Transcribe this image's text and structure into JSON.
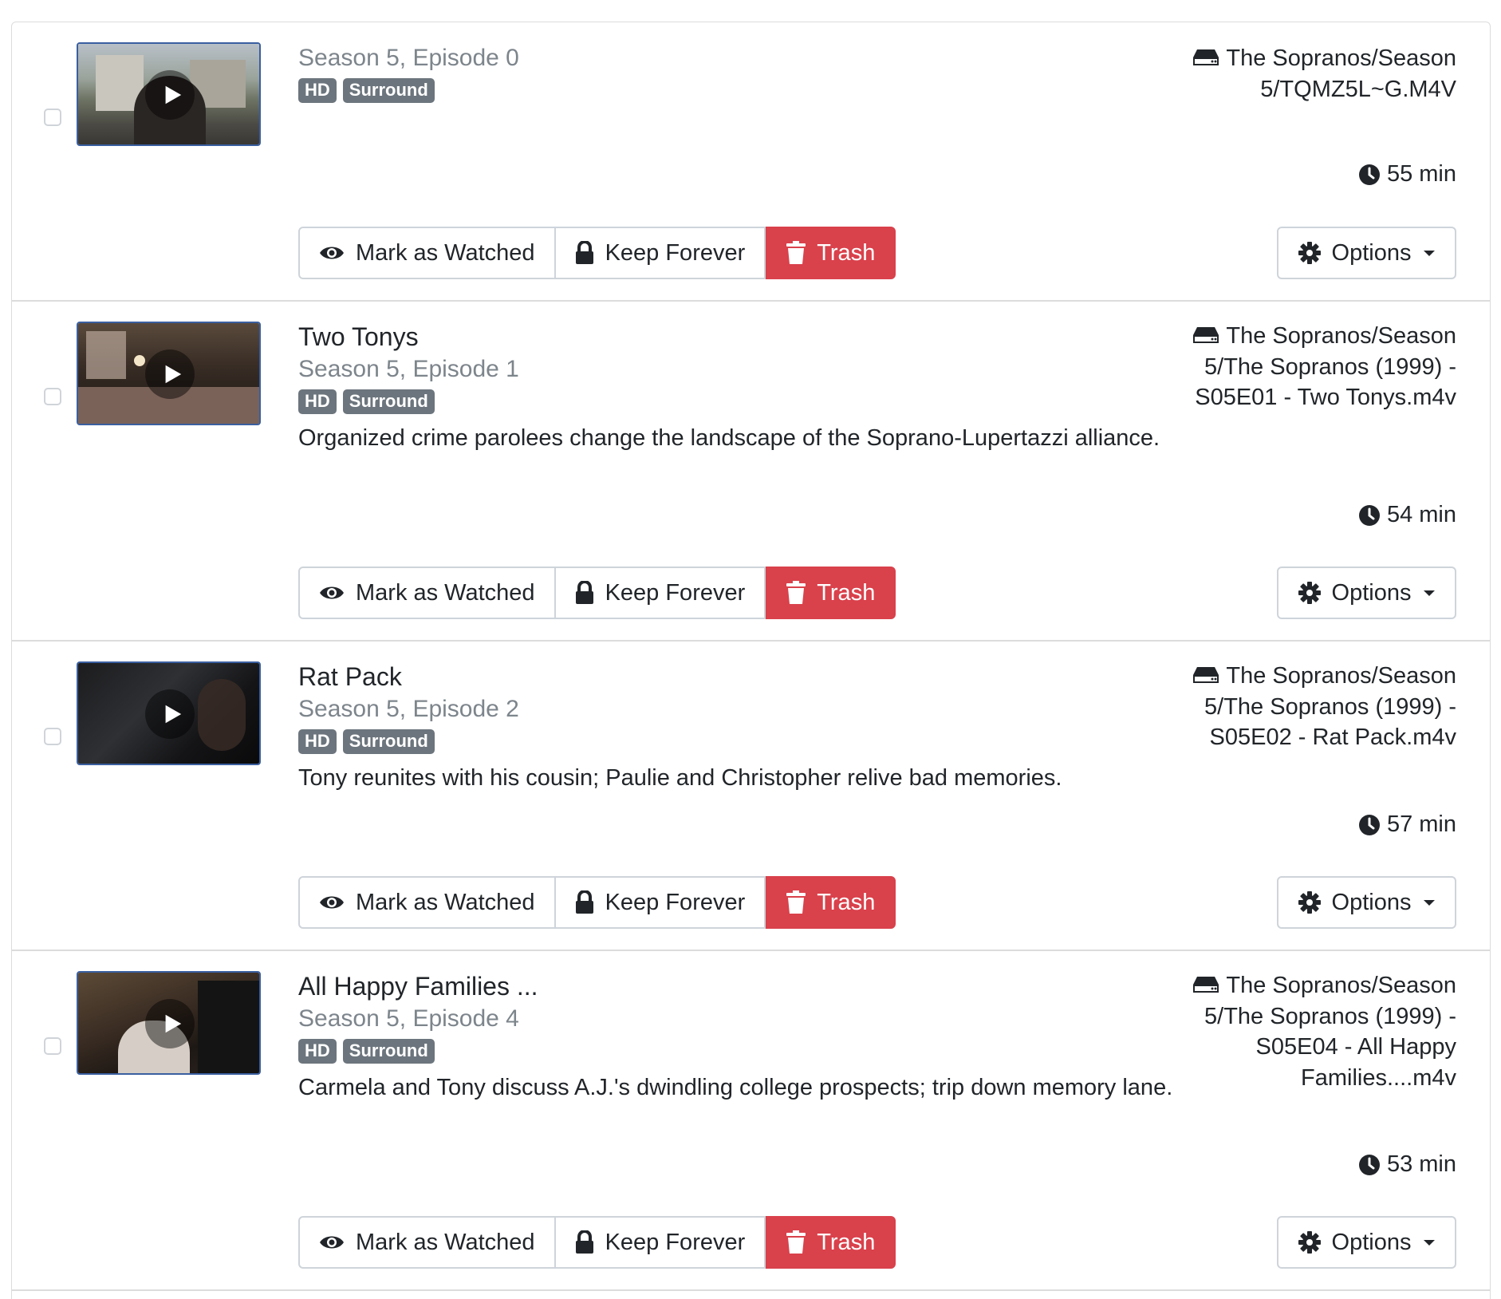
{
  "episodes": [
    {
      "title": "",
      "episode": "Season 5, Episode 0",
      "badges": [
        "HD",
        "Surround"
      ],
      "description": "",
      "path": "The Sopranos/Season 5/TQMZ5L~G.M4V",
      "duration": "55 min"
    },
    {
      "title": "Two Tonys",
      "episode": "Season 5, Episode 1",
      "badges": [
        "HD",
        "Surround"
      ],
      "description": "Organized crime parolees change the landscape of the Soprano-Lupertazzi alliance.",
      "path": "The Sopranos/Season 5/The Sopranos (1999) - S05E01 - Two Tonys.m4v",
      "duration": "54 min"
    },
    {
      "title": "Rat Pack",
      "episode": "Season 5, Episode 2",
      "badges": [
        "HD",
        "Surround"
      ],
      "description": "Tony reunites with his cousin; Paulie and Christopher relive bad memories.",
      "path": "The Sopranos/Season 5/The Sopranos (1999) - S05E02 - Rat Pack.m4v",
      "duration": "57 min"
    },
    {
      "title": "All Happy Families ...",
      "episode": "Season 5, Episode 4",
      "badges": [
        "HD",
        "Surround"
      ],
      "description": "Carmela and Tony discuss A.J.'s dwindling college prospects; trip down memory lane.",
      "path": "The Sopranos/Season 5/The Sopranos (1999) - S05E04 - All Happy Families....m4v",
      "duration": "53 min"
    }
  ],
  "actions": {
    "mark_watched": "Mark as Watched",
    "keep_forever": "Keep Forever",
    "trash": "Trash",
    "options": "Options"
  },
  "colors": {
    "danger": "#d9414b",
    "badge": "#6c757d",
    "muted": "#7d858c",
    "border": "#ced4da",
    "thumb_border": "#3a5fa0"
  },
  "icons": {
    "drive": "hdd-icon",
    "clock": "clock-icon",
    "eye": "eye-icon",
    "lock": "lock-icon",
    "trash": "trash-icon",
    "gear": "gear-icon",
    "play": "play-icon"
  }
}
